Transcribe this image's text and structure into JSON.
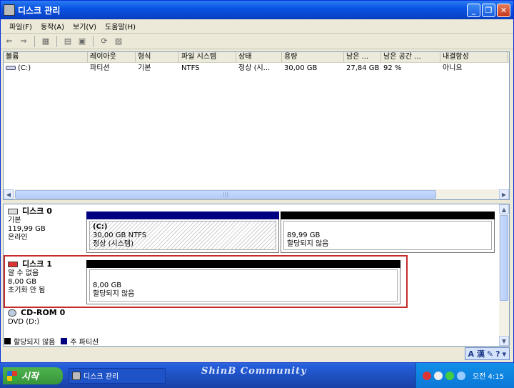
{
  "window": {
    "title": "디스크 관리",
    "buttons": [
      "_",
      "❐",
      "✕"
    ]
  },
  "menu": [
    "파일(F)",
    "동작(A)",
    "보기(V)",
    "도움말(H)"
  ],
  "volume_list": {
    "headers": [
      "볼륨",
      "레이아웃",
      "형식",
      "파일 시스템",
      "상태",
      "용량",
      "남은 ...",
      "남은 공간 ...",
      "내결함성"
    ],
    "rows": [
      {
        "volume": "(C:)",
        "layout": "파티션",
        "type": "기본",
        "fs": "NTFS",
        "status": "정상 (시...",
        "capacity": "30,00 GB",
        "free": "27,84 GB",
        "free_pct": "92 %",
        "fault": "아니요"
      }
    ],
    "scroll_grip": "|||"
  },
  "disks": [
    {
      "name": "디스크 0",
      "type": "기본",
      "size": "119,99 GB",
      "state": "온라인",
      "partitions": [
        {
          "label": "(C:)",
          "line1": "30,00 GB NTFS",
          "line2": "정상 (시스템)",
          "bar_color": "#000080"
        },
        {
          "label": "",
          "line1": "89,99 GB",
          "line2": "할당되지 않음",
          "bar_color": "#000000"
        }
      ]
    },
    {
      "name": "디스크 1",
      "type": "알 수 없음",
      "size": "8,00 GB",
      "state": "초기화 안 됨",
      "partitions": [
        {
          "label": "",
          "line1": "8,00 GB",
          "line2": "할당되지 않음",
          "bar_color": "#000000"
        }
      ]
    },
    {
      "name": "CD-ROM 0",
      "type": "DVD (D:)",
      "size": "",
      "state": "",
      "partitions": []
    }
  ],
  "legend": [
    {
      "label": "할당되지 않음",
      "color": "#000000"
    },
    {
      "label": "주 파티션",
      "color": "#000080"
    }
  ],
  "langbar": {
    "text": "A 漢"
  },
  "taskbar": {
    "start_label": "시작",
    "task_label": "디스크 관리",
    "brand": "ShinB Community",
    "clock": "오전 4:15"
  },
  "colors": {
    "accent": "#0a54e3",
    "highlight": "#c62a2a"
  }
}
